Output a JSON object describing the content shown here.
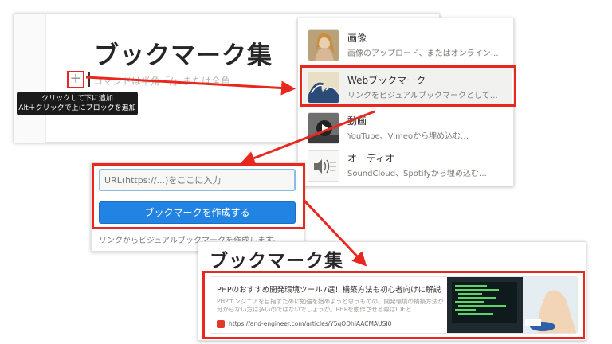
{
  "editor": {
    "title": "ブックマーク集",
    "add_icon": "plus-icon",
    "placeholder": "コマンドは半角「/」または全角",
    "tooltip_line1": "クリックして下に追加",
    "tooltip_line2": "Alt＋クリックで上にブロックを追加"
  },
  "block_menu": {
    "items": [
      {
        "name": "画像",
        "desc": "画像のアップロード、またはオンライン…",
        "thumb": "painting-thumbnail"
      },
      {
        "name": "Webブックマーク",
        "desc": "リンクをビジュアルブックマークとして…",
        "thumb": "wave-painting-thumbnail"
      },
      {
        "name": "動画",
        "desc": "YouTube、Vimeoから埋め込む…",
        "thumb": "video-play-thumbnail"
      },
      {
        "name": "オーディオ",
        "desc": "SoundCloud、Spotifyから埋め込む…",
        "thumb": "speaker-thumbnail"
      }
    ]
  },
  "bookmark_form": {
    "url_placeholder": "URL(https://...)をここに入力",
    "create_button": "ブックマークを作成する",
    "hint": "リンクからビジュアルブックマークを作成します。"
  },
  "result": {
    "title": "ブックマーク集",
    "card_title": "PHPのおすすめ開発環境ツール7選！構築方法も初心者向けに解説",
    "card_desc": "PHPエンジニアを目指すために勉強を始めようと思うものの、開発環境の構築方法が分からない方は多いのではないでしょうか。PHPを動作させる際はIDEと",
    "card_url": "https://and-engineer.com/articles/Y5qODhIAACMAUSI0"
  },
  "colors": {
    "highlight": "#e8281f",
    "button": "#2383e2",
    "input_border": "#88bde8"
  }
}
